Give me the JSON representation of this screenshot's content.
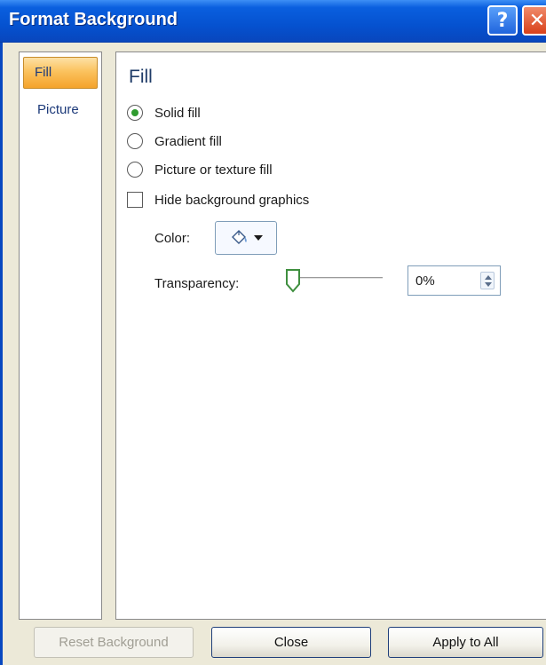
{
  "window": {
    "title": "Format Background",
    "help_glyph": "?",
    "close_glyph": "✕"
  },
  "nav": {
    "items": [
      {
        "label": "Fill",
        "selected": true
      },
      {
        "label": "Picture",
        "selected": false
      }
    ]
  },
  "fill": {
    "heading": "Fill",
    "options": [
      {
        "label": "Solid fill",
        "selected": true
      },
      {
        "label": "Gradient fill",
        "selected": false
      },
      {
        "label": "Picture or texture fill",
        "selected": false
      }
    ],
    "hide_background": {
      "label": "Hide background graphics",
      "checked": false
    },
    "color": {
      "label": "Color:",
      "icon": "paint-bucket-icon"
    },
    "transparency": {
      "label": "Transparency:",
      "value": "0%",
      "level": 0
    }
  },
  "buttons": {
    "reset": "Reset Background",
    "close": "Close",
    "apply": "Apply to All"
  },
  "colors": {
    "title_bar": "#0552d0",
    "nav_selected": "#fbc25e",
    "radio_selected": "#2f9b2f",
    "dialog_face": "#ece9d8"
  }
}
